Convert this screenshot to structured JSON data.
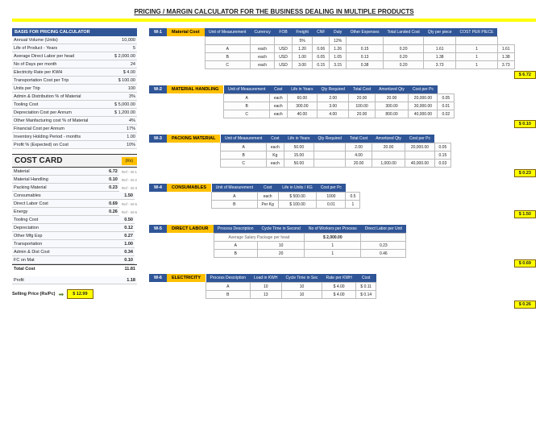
{
  "title": "PRICING / MARGIN CALCULATOR FOR THE BUSINESS DEALING IN MULTIPLE PRODUCTS",
  "basis": {
    "header": "BASIS FOR PRICING CALCULATOR",
    "rows": [
      {
        "k": "Annual Volume (Units)",
        "v": "10,000"
      },
      {
        "k": "Life of Product - Years",
        "v": "5"
      },
      {
        "k": "Average Direct Labor per head",
        "v": "$   2,000.00"
      },
      {
        "k": "No of Days per month",
        "v": "24"
      },
      {
        "k": "Electricity Rate per KWH",
        "v": "$   4.00"
      },
      {
        "k": "Transportation Cost per Trip",
        "v": "$ 100.00"
      },
      {
        "k": "Units per Trip",
        "v": "100"
      },
      {
        "k": "Admin & Distribution % of Material",
        "v": "3%"
      },
      {
        "k": "Tooling Cost",
        "v": "$ 5,000.00"
      },
      {
        "k": "Depreciation Cost per Annum",
        "v": "$ 1,200.00"
      },
      {
        "k": "Other Manfacturing cost % of Material",
        "v": "4%"
      },
      {
        "k": "Financial Cost per Annum",
        "v": "17%"
      },
      {
        "k": "Inventory Holding Period - months",
        "v": "1.00"
      },
      {
        "k": "Profit % (Expected) on Cost",
        "v": "10%"
      }
    ]
  },
  "costcard": {
    "title": "COST CARD",
    "unit": "(Rs)",
    "rows": [
      {
        "k": "Material",
        "v": "6.72",
        "ref": "Ref - W-1"
      },
      {
        "k": "Material Handling",
        "v": "0.10",
        "ref": "Ref - W-2"
      },
      {
        "k": "Packing Material",
        "v": "0.23",
        "ref": "Ref - W-3"
      },
      {
        "k": "Consumables",
        "v": "1.50",
        "ref": ""
      },
      {
        "k": "Direct Labor Cost",
        "v": "0.69",
        "ref": "Ref - W-5"
      },
      {
        "k": "Energy",
        "v": "0.26",
        "ref": "Ref - W-6"
      },
      {
        "k": "Tooling Cost",
        "v": "0.50",
        "ref": ""
      },
      {
        "k": "Depreciation",
        "v": "0.12",
        "ref": ""
      },
      {
        "k": "Other Mfg Exp",
        "v": "0.27",
        "ref": ""
      },
      {
        "k": "Transportation",
        "v": "1.00",
        "ref": ""
      },
      {
        "k": "Admin & Dist Cost",
        "v": "0.34",
        "ref": ""
      },
      {
        "k": "FC on Mat",
        "v": "0.10",
        "ref": ""
      }
    ],
    "total_label": "Total Cost",
    "total": "11.81",
    "profit_label": "Profit",
    "profit": "1.18",
    "selling_label": "Selling Price (Rs/Pc)",
    "selling": "$   12.99"
  },
  "w1": {
    "tag": "W-1",
    "name": "Material Cost",
    "headers": [
      "",
      "Unit of Measurement",
      "Currency",
      "FOB",
      "Freight",
      "CNF",
      "Duty",
      "Other Expenses",
      "Total Landed Cost",
      "Qty per piece",
      "COST PER PIECE"
    ],
    "sub": [
      "",
      "",
      "",
      "",
      "5%",
      "",
      "12%",
      "",
      "",
      "",
      ""
    ],
    "rows": [
      [
        "A",
        "each",
        "USD",
        "1.20",
        "0.06",
        "1.26",
        "0.15",
        "0.20",
        "1.61",
        "1",
        "1.61"
      ],
      [
        "B",
        "each",
        "USD",
        "1.00",
        "0.05",
        "1.05",
        "0.13",
        "0.20",
        "1.38",
        "1",
        "1.38"
      ],
      [
        "C",
        "each",
        "USD",
        "3.00",
        "0.15",
        "3.15",
        "0.38",
        "0.20",
        "3.73",
        "1",
        "3.73"
      ]
    ],
    "sum": "$   6.72"
  },
  "w2": {
    "tag": "W-2",
    "name": "MATERIAL HANDLING",
    "headers": [
      "",
      "Unit of Measurement",
      "Cost",
      "Life in Years",
      "Qty Required",
      "Total Cost",
      "Amortized Qty",
      "Cost per Pc"
    ],
    "rows": [
      [
        "A",
        "each",
        "60.00",
        "2.00",
        "20.00",
        "20.00",
        "20,000.00",
        "0.05"
      ],
      [
        "B",
        "each",
        "300.00",
        "3.00",
        "100.00",
        "300.00",
        "30,000.00",
        "0.01"
      ],
      [
        "C",
        "each",
        "40.00",
        "4.00",
        "20.00",
        "800.00",
        "40,000.00",
        "0.02"
      ]
    ],
    "sum": "$   0.10"
  },
  "w3": {
    "tag": "W-3",
    "name": "PACKING MATERIAL",
    "headers": [
      "",
      "Unit of Measurement",
      "Cost",
      "Life in Years",
      "Qty Required",
      "Total Cost",
      "Amortized Qty",
      "Cost per Pc"
    ],
    "rows": [
      [
        "A",
        "each",
        "50.00",
        "",
        "2.00",
        "20.00",
        "20,000.00",
        "0.05"
      ],
      [
        "B",
        "Kg",
        "15.00",
        "",
        "4.00",
        "",
        "",
        "0.15"
      ],
      [
        "C",
        "each",
        "50.00",
        "",
        "20.00",
        "1,000.00",
        "40,000.00",
        "0.03"
      ]
    ],
    "sum": "$   0.23"
  },
  "w4": {
    "tag": "W-4",
    "name": "CONSUMABLES",
    "headers": [
      "",
      "Unit of Measurement",
      "Cost",
      "Life in Units / KG",
      "Cost per Pc"
    ],
    "rows": [
      [
        "A",
        "each",
        "$   500.00",
        "1000",
        "0.5"
      ],
      [
        "B",
        "Per Kg",
        "$   100.00",
        "0.01",
        "1"
      ]
    ],
    "sum": "$   1.50"
  },
  "w5": {
    "tag": "W-5",
    "name": "DIRECT LABOUR",
    "headers": [
      "",
      "Process Description",
      "Cycle Time in Second",
      "No of Workers per Process",
      "Direct Labor per Unit"
    ],
    "sal_hint": "Average Salary Package per head",
    "sal": "$ 2,000.00",
    "rows": [
      [
        "",
        "A",
        "10",
        "1",
        "0.23"
      ],
      [
        "",
        "B",
        "20",
        "1",
        "0.46"
      ]
    ],
    "sum": "$   0.69"
  },
  "w6": {
    "tag": "W-6",
    "name": "ELECTRICITY",
    "headers": [
      "",
      "Process Description",
      "Load in KWH",
      "Cycle Time in Sec",
      "Rate per KWH",
      "Cost"
    ],
    "rows": [
      [
        "",
        "A",
        "10",
        "10",
        "$   4.00",
        "$ 0.11"
      ],
      [
        "",
        "B",
        "13",
        "10",
        "$   4.00",
        "$ 0.14"
      ]
    ],
    "sum": "$   0.26"
  }
}
